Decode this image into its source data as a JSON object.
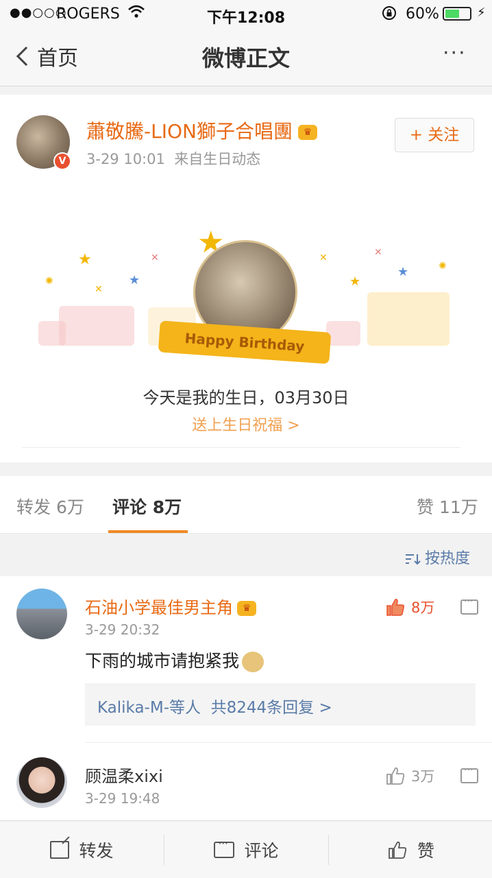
{
  "status_bar": {
    "signal": "●●○○○",
    "carrier": "ROGERS",
    "time": "下午12:08",
    "battery_percent": "60%",
    "battery_level": 0.6
  },
  "nav": {
    "back_label": "首页",
    "title": "微博正文",
    "more_label": "···"
  },
  "post": {
    "author": "蕭敬騰-LION獅子合唱團",
    "time": "3-29 10:01",
    "source": "来自生日动态",
    "follow_label": "+ 关注",
    "banner_text": "Happy Birthday",
    "birthday_text": "今天是我的生日，03月30日",
    "wish_link": "送上生日祝福 >"
  },
  "tabs": [
    {
      "label": "转发",
      "count": "6万"
    },
    {
      "label": "评论",
      "count": "8万"
    },
    {
      "label": "赞",
      "count": "11万"
    }
  ],
  "sort_label": "按热度",
  "comments": [
    {
      "user": "石油小学最佳男主角",
      "time": "3-29 20:32",
      "text": "下雨的城市请抱紧我",
      "likes": "8万",
      "replies_by": "Kalika-M-等人",
      "replies_count": "共8244条回复 >"
    },
    {
      "user": "顾温柔xixi",
      "time": "3-29 19:48",
      "likes": "3万"
    }
  ],
  "toolbar": {
    "share_label": "转发",
    "comment_label": "评论",
    "like_label": "赞"
  },
  "colors": {
    "accent": "#e86a14",
    "link_blue": "#5a7ba8",
    "like_red": "#e8502f"
  }
}
